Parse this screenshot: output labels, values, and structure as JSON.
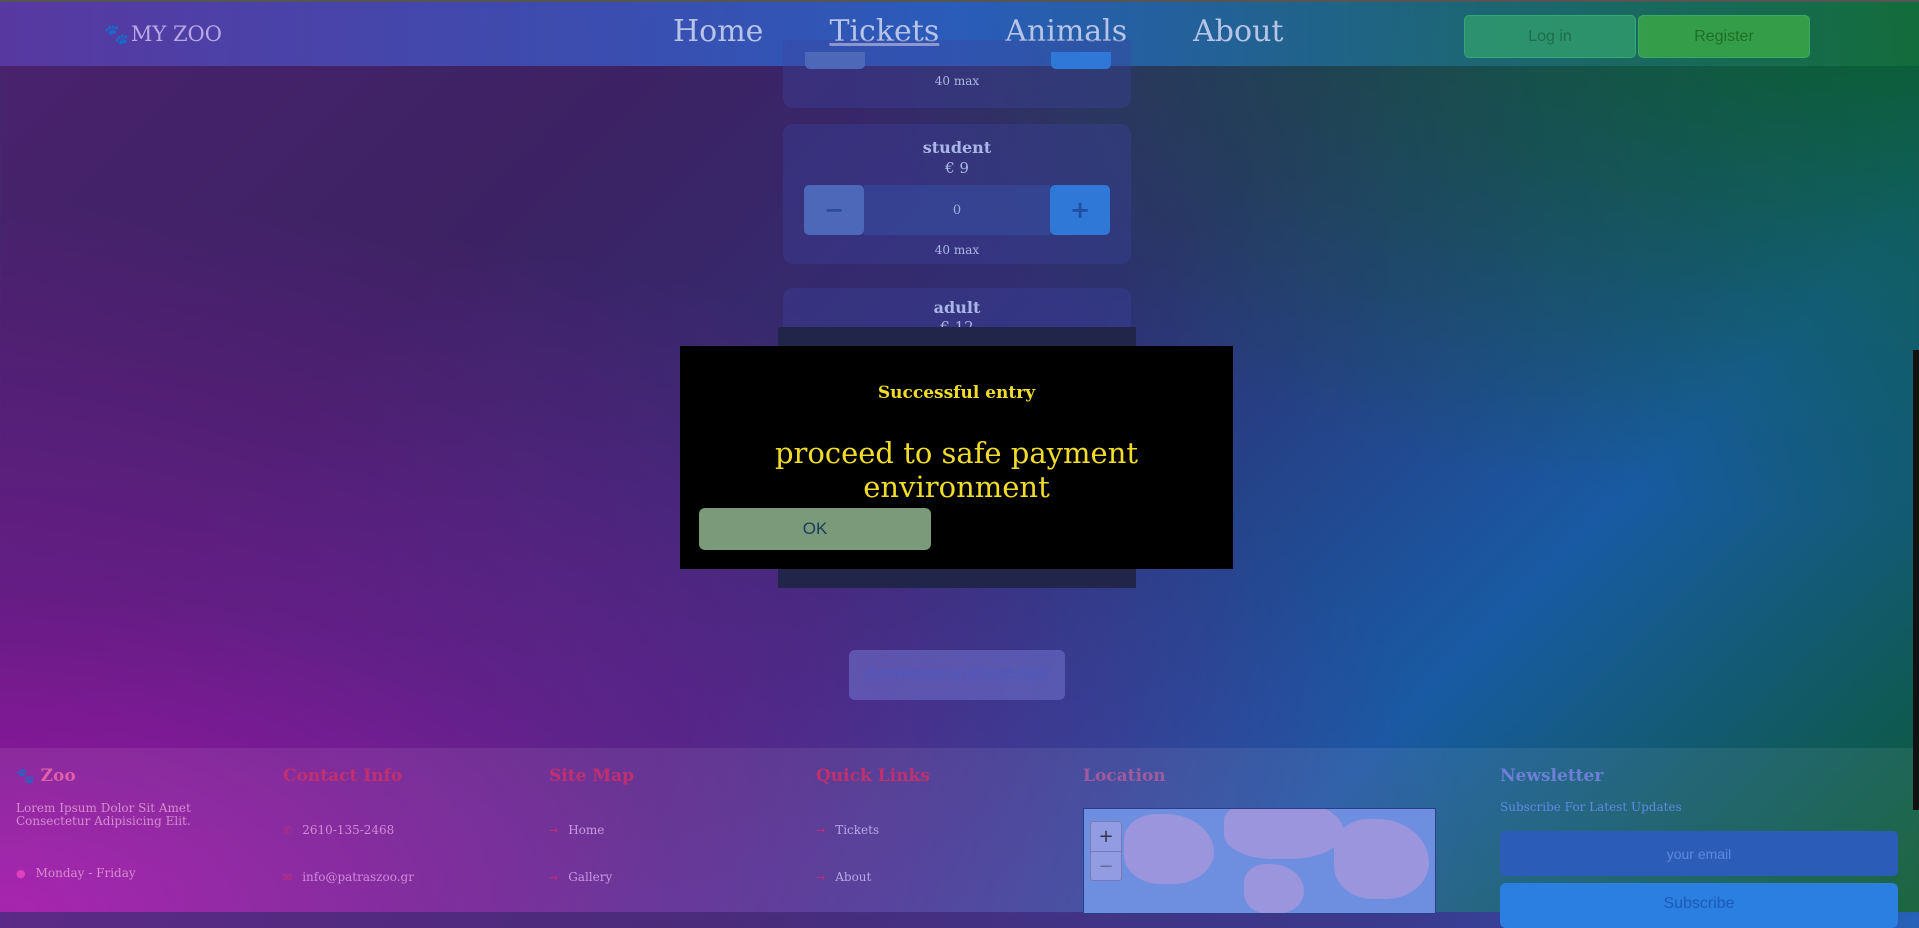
{
  "nav": {
    "logo": "MY ZOO",
    "links": [
      "Home",
      "Tickets",
      "Animals",
      "About"
    ],
    "login": "Log in",
    "register": "Register"
  },
  "tickets": {
    "prev_max": "40 max",
    "student": {
      "name": "student",
      "price": "€ 9",
      "minus": "−",
      "value": "0",
      "plus": "+",
      "max": "40 max"
    },
    "adult": {
      "name": "adult",
      "price": "€ 12"
    }
  },
  "modal": {
    "title": "Successful entry",
    "message": "proceed to safe payment environment",
    "ok": "OK"
  },
  "admin_button": "Administration Dashboard",
  "footer": {
    "zoo": {
      "title": "Zoo",
      "text": "Lorem Ipsum Dolor Sit Amet Consectetur Adipisicing Elit.",
      "hours": "Monday - Friday"
    },
    "contact": {
      "title": "Contact Info",
      "phone": "2610-135-2468",
      "email": "info@patraszoo.gr"
    },
    "sitemap": {
      "title": "Site Map",
      "items": [
        "Home",
        "Gallery"
      ]
    },
    "quicklinks": {
      "title": "Quick Links",
      "items": [
        "Tickets",
        "About"
      ]
    },
    "location": {
      "title": "Location",
      "zoom_in": "+",
      "zoom_out": "−"
    },
    "newsletter": {
      "title": "Newsletter",
      "subtitle": "Subscribe For Latest Updates",
      "placeholder": "your email",
      "button": "Subscribe"
    }
  }
}
